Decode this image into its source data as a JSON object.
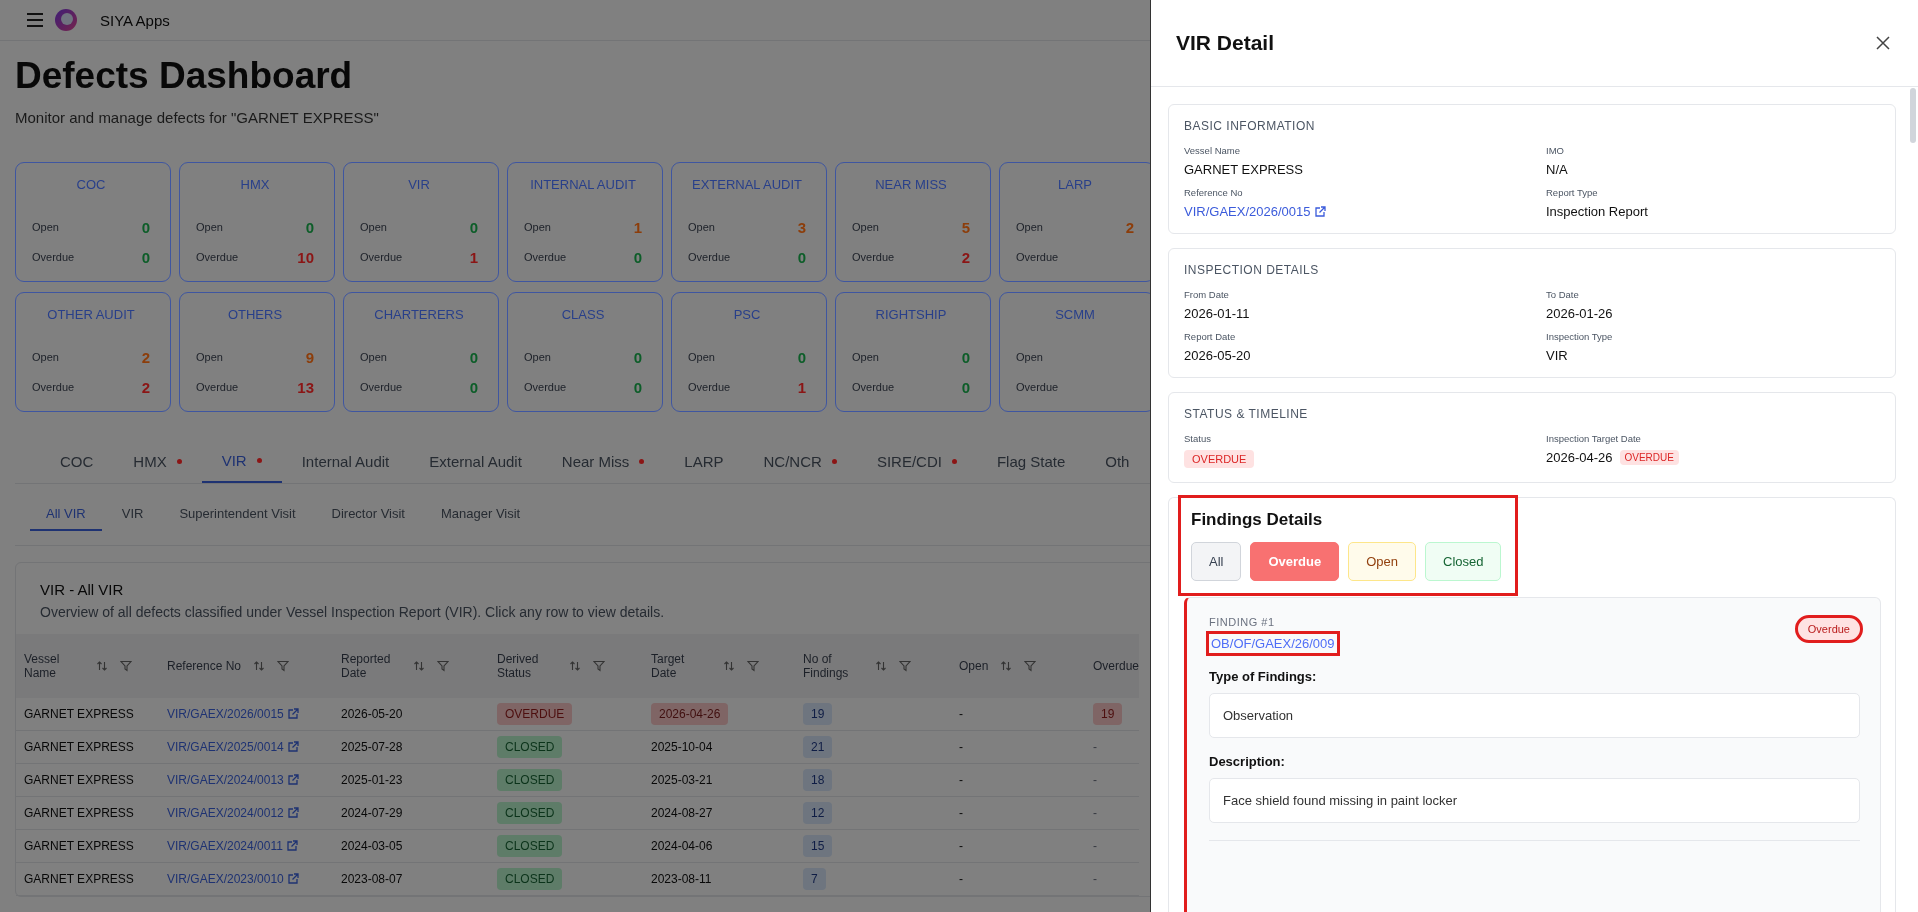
{
  "app": {
    "name": "SIYA Apps"
  },
  "page": {
    "title": "Defects Dashboard",
    "subtitle": "Monitor and manage defects for \"GARNET EXPRESS\""
  },
  "summary_cards": [
    {
      "title": "COC",
      "metrics": [
        {
          "label": "Open",
          "value": "0",
          "color": "#0c5d28"
        },
        {
          "label": "Overdue",
          "value": "0",
          "color": "#0c5d28"
        }
      ]
    },
    {
      "title": "HMX",
      "metrics": [
        {
          "label": "Open",
          "value": "0",
          "color": "#0c5d28"
        },
        {
          "label": "Overdue",
          "value": "10",
          "color": "#8b1515"
        }
      ]
    },
    {
      "title": "VIR",
      "metrics": [
        {
          "label": "Open",
          "value": "0",
          "color": "#0c5d28"
        },
        {
          "label": "Overdue",
          "value": "1",
          "color": "#8b1515"
        }
      ]
    },
    {
      "title": "INTERNAL AUDIT",
      "metrics": [
        {
          "label": "Open",
          "value": "1",
          "color": "#8c3d0a"
        },
        {
          "label": "Overdue",
          "value": "0",
          "color": "#0c5d28"
        }
      ]
    },
    {
      "title": "EXTERNAL AUDIT",
      "metrics": [
        {
          "label": "Open",
          "value": "3",
          "color": "#8c3d0a"
        },
        {
          "label": "Overdue",
          "value": "0",
          "color": "#0c5d28"
        }
      ]
    },
    {
      "title": "NEAR MISS",
      "metrics": [
        {
          "label": "Open",
          "value": "5",
          "color": "#8c3d0a"
        },
        {
          "label": "Overdue",
          "value": "2",
          "color": "#8b1515"
        }
      ]
    },
    {
      "title": "LARP",
      "metrics": [
        {
          "label": "Open",
          "value": "2",
          "color": "#8c3d0a"
        },
        {
          "label": "Overdue"
        }
      ]
    },
    {
      "title": "OTHER AUDIT",
      "metrics": [
        {
          "label": "Open",
          "value": "2",
          "color": "#8c3d0a"
        },
        {
          "label": "Overdue",
          "value": "2",
          "color": "#8b1515"
        }
      ]
    },
    {
      "title": "OTHERS",
      "metrics": [
        {
          "label": "Open",
          "value": "9",
          "color": "#8c3d0a"
        },
        {
          "label": "Overdue",
          "value": "13",
          "color": "#8b1515"
        }
      ]
    },
    {
      "title": "CHARTERERS",
      "metrics": [
        {
          "label": "Open",
          "value": "0",
          "color": "#0c5d28"
        },
        {
          "label": "Overdue",
          "value": "0",
          "color": "#0c5d28"
        }
      ]
    },
    {
      "title": "CLASS",
      "metrics": [
        {
          "label": "Open",
          "value": "0",
          "color": "#0c5d28"
        },
        {
          "label": "Overdue",
          "value": "0",
          "color": "#0c5d28"
        }
      ]
    },
    {
      "title": "PSC",
      "metrics": [
        {
          "label": "Open",
          "value": "0",
          "color": "#0c5d28"
        },
        {
          "label": "Overdue",
          "value": "1",
          "color": "#8b1515"
        }
      ]
    },
    {
      "title": "RIGHTSHIP",
      "metrics": [
        {
          "label": "Open",
          "value": "0",
          "color": "#0c5d28"
        },
        {
          "label": "Overdue",
          "value": "0",
          "color": "#0c5d28"
        }
      ]
    },
    {
      "title": "SCMM",
      "metrics": [
        {
          "label": "Open"
        },
        {
          "label": "Overdue"
        }
      ]
    }
  ],
  "tabs": [
    {
      "label": "COC",
      "selected": false,
      "alert": false
    },
    {
      "label": "HMX",
      "selected": false,
      "alert": true
    },
    {
      "label": "VIR",
      "selected": true,
      "alert": true
    },
    {
      "label": "Internal Audit",
      "selected": false,
      "alert": false
    },
    {
      "label": "External Audit",
      "selected": false,
      "alert": false
    },
    {
      "label": "Near Miss",
      "selected": false,
      "alert": true
    },
    {
      "label": "LARP",
      "selected": false,
      "alert": false
    },
    {
      "label": "NC/NCR",
      "selected": false,
      "alert": true
    },
    {
      "label": "SIRE/CDI",
      "selected": false,
      "alert": true
    },
    {
      "label": "Flag State",
      "selected": false,
      "alert": false
    },
    {
      "label": "Oth",
      "selected": false,
      "alert": false
    }
  ],
  "subtabs": [
    {
      "label": "All VIR",
      "selected": true
    },
    {
      "label": "VIR",
      "selected": false
    },
    {
      "label": "Superintendent Visit",
      "selected": false
    },
    {
      "label": "Director Visit",
      "selected": false
    },
    {
      "label": "Manager Visit",
      "selected": false
    }
  ],
  "table": {
    "title": "VIR - All VIR",
    "description": "Overview of all defects classified under Vessel Inspection Report (VIR). Click any row to view details.",
    "columns": [
      "Vessel Name",
      "Reference No",
      "Reported Date",
      "Derived Status",
      "Target Date",
      "No of Findings",
      "Open",
      "Overdue"
    ],
    "rows": [
      {
        "vessel_name": "GARNET EXPRESS",
        "reference_no": "VIR/GAEX/2026/0015",
        "reported_date": "2026-05-20",
        "derived_status": {
          "text": "OVERDUE",
          "kind": "overdue"
        },
        "target_date": {
          "text": "2026-04-26",
          "overdue": true
        },
        "no_of_findings": "19",
        "open": "-",
        "overdue": {
          "text": "19",
          "kind": "count"
        }
      },
      {
        "vessel_name": "GARNET EXPRESS",
        "reference_no": "VIR/GAEX/2025/0014",
        "reported_date": "2025-07-28",
        "derived_status": {
          "text": "CLOSED",
          "kind": "closed"
        },
        "target_date": {
          "text": "2025-10-04",
          "overdue": false
        },
        "no_of_findings": "21",
        "open": "-",
        "overdue": {
          "text": "-",
          "kind": "none"
        }
      },
      {
        "vessel_name": "GARNET EXPRESS",
        "reference_no": "VIR/GAEX/2024/0013",
        "reported_date": "2025-01-23",
        "derived_status": {
          "text": "CLOSED",
          "kind": "closed"
        },
        "target_date": {
          "text": "2025-03-21",
          "overdue": false
        },
        "no_of_findings": "18",
        "open": "-",
        "overdue": {
          "text": "-",
          "kind": "none"
        }
      },
      {
        "vessel_name": "GARNET EXPRESS",
        "reference_no": "VIR/GAEX/2024/0012",
        "reported_date": "2024-07-29",
        "derived_status": {
          "text": "CLOSED",
          "kind": "closed"
        },
        "target_date": {
          "text": "2024-08-27",
          "overdue": false
        },
        "no_of_findings": "12",
        "open": "-",
        "overdue": {
          "text": "-",
          "kind": "none"
        }
      },
      {
        "vessel_name": "GARNET EXPRESS",
        "reference_no": "VIR/GAEX/2024/0011",
        "reported_date": "2024-03-05",
        "derived_status": {
          "text": "CLOSED",
          "kind": "closed"
        },
        "target_date": {
          "text": "2024-04-06",
          "overdue": false
        },
        "no_of_findings": "15",
        "open": "-",
        "overdue": {
          "text": "-",
          "kind": "none"
        }
      },
      {
        "vessel_name": "GARNET EXPRESS",
        "reference_no": "VIR/GAEX/2023/0010",
        "reported_date": "2023-08-07",
        "derived_status": {
          "text": "CLOSED",
          "kind": "closed"
        },
        "target_date": {
          "text": "2023-08-11",
          "overdue": false
        },
        "no_of_findings": "7",
        "open": "-",
        "overdue": {
          "text": "-",
          "kind": "none"
        }
      }
    ]
  },
  "drawer": {
    "title": "VIR Detail",
    "sections": [
      {
        "heading": "BASIC INFORMATION",
        "fields": [
          {
            "label": "Vessel Name",
            "value": "GARNET EXPRESS",
            "kind": "text"
          },
          {
            "label": "IMO",
            "value": "N/A",
            "kind": "text"
          },
          {
            "label": "Reference No",
            "value": "VIR/GAEX/2026/0015",
            "kind": "link"
          },
          {
            "label": "Report Type",
            "value": "Inspection Report",
            "kind": "text"
          }
        ]
      },
      {
        "heading": "INSPECTION DETAILS",
        "fields": [
          {
            "label": "From Date",
            "value": "2026-01-11",
            "kind": "text"
          },
          {
            "label": "To Date",
            "value": "2026-01-26",
            "kind": "text"
          },
          {
            "label": "Report Date",
            "value": "2026-05-20",
            "kind": "text"
          },
          {
            "label": "Inspection Type",
            "value": "VIR",
            "kind": "text"
          }
        ]
      },
      {
        "heading": "STATUS & TIMELINE",
        "fields": [
          {
            "label": "Status",
            "value": "OVERDUE",
            "kind": "badge"
          },
          {
            "label": "Inspection Target Date",
            "value": "2026-04-26",
            "kind": "text",
            "badge": "OVERDUE"
          }
        ]
      }
    ],
    "findings": {
      "heading": "Findings Details",
      "highlighted": true,
      "filters": [
        {
          "label": "All",
          "kind": "all",
          "selected": false
        },
        {
          "label": "Overdue",
          "kind": "overdue",
          "selected": true
        },
        {
          "label": "Open",
          "kind": "open",
          "selected": false
        },
        {
          "label": "Closed",
          "kind": "closed",
          "selected": false
        }
      ],
      "items": [
        {
          "label": "FINDING #1",
          "reference": "OB/OF/GAEX/26/009",
          "reference_highlighted": true,
          "status": "Overdue",
          "kind": "overdue",
          "status_highlighted": true,
          "fields": [
            {
              "label": "Type of Findings:",
              "value": "Observation"
            },
            {
              "label": "Description:",
              "value": "Face shield found missing in paint locker"
            }
          ]
        }
      ]
    }
  }
}
